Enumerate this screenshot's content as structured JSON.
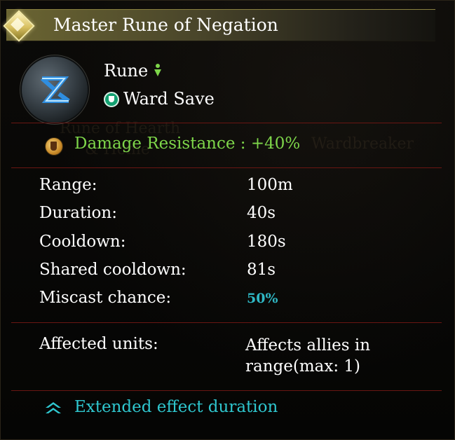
{
  "tooltip": {
    "title": "Master Rune of Negation",
    "icons": {
      "title": "gold-diamond-icon",
      "rune": "blue-rune-icon",
      "type": "green-arrow-down-icon",
      "save": "ward-save-shield-icon",
      "effect": "damage-resistance-shield-icon",
      "extended": "cyan-chevron-up-icon"
    },
    "type_label": "Rune",
    "save_label": "Ward Save",
    "effect": {
      "text": "Damage Resistance : +40%",
      "color": "#7ed64a"
    },
    "stats": [
      {
        "label": "Range:",
        "value": "100m"
      },
      {
        "label": "Duration:",
        "value": "40s"
      },
      {
        "label": "Cooldown:",
        "value": "180s"
      },
      {
        "label": "Shared cooldown:",
        "value": "81s"
      },
      {
        "label": "Miscast chance:",
        "value": "50%",
        "color": "#2fb7c4"
      }
    ],
    "affected": {
      "label": "Affected units:",
      "value": "Affects allies in range(max: 1)"
    },
    "extended": {
      "text": "Extended effect duration",
      "color": "#2fc7cf"
    },
    "background_ghost_text": [
      "Rune of Hearth",
      "& Home",
      "Wardbreaker"
    ],
    "colors": {
      "divider": "#6a1612",
      "title_bar": "#6b6532"
    }
  }
}
